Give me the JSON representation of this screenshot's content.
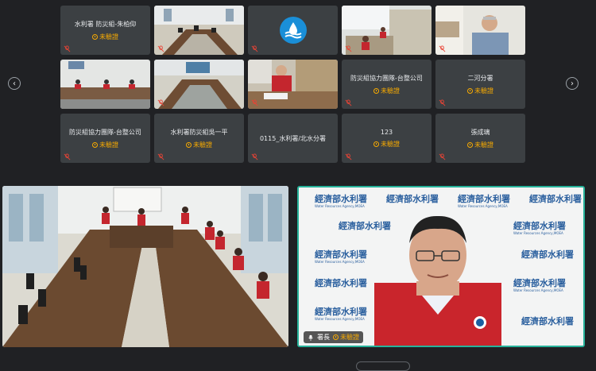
{
  "tiles": [
    {
      "name": "水利署 防災組-朱柏仰",
      "status": "未驗證",
      "type": "text"
    },
    {
      "type": "video-meeting"
    },
    {
      "type": "logo"
    },
    {
      "type": "video-office"
    },
    {
      "type": "video-person"
    },
    {
      "type": "video-meeting2"
    },
    {
      "type": "video-meeting3"
    },
    {
      "type": "video-desk"
    },
    {
      "name": "防災組協力團隊-台整公司",
      "status": "未驗證",
      "type": "text"
    },
    {
      "name": "二河分署",
      "status": "未驗證",
      "type": "text"
    },
    {
      "name": "防災組協力團隊-台整公司",
      "status": "未驗證",
      "type": "text"
    },
    {
      "name": "水利署防災組吳一平",
      "status": "未驗證",
      "type": "text"
    },
    {
      "name": "0115_水利署/北水分署",
      "status": "",
      "type": "text"
    },
    {
      "name": "123",
      "status": "未驗證",
      "type": "text"
    },
    {
      "name": "張成璃",
      "status": "未驗證",
      "type": "text"
    }
  ],
  "speaker": {
    "name": "署長",
    "status": "未驗證"
  },
  "watermark": {
    "text": "經濟部水利署",
    "sub": "Water Resources Agency,MOEA"
  },
  "nav": {
    "prev": "‹",
    "next": "›"
  },
  "colors": {
    "accent": "#27b39b",
    "warning": "#f9ab00",
    "tile": "#3c4043",
    "background": "#202124"
  }
}
